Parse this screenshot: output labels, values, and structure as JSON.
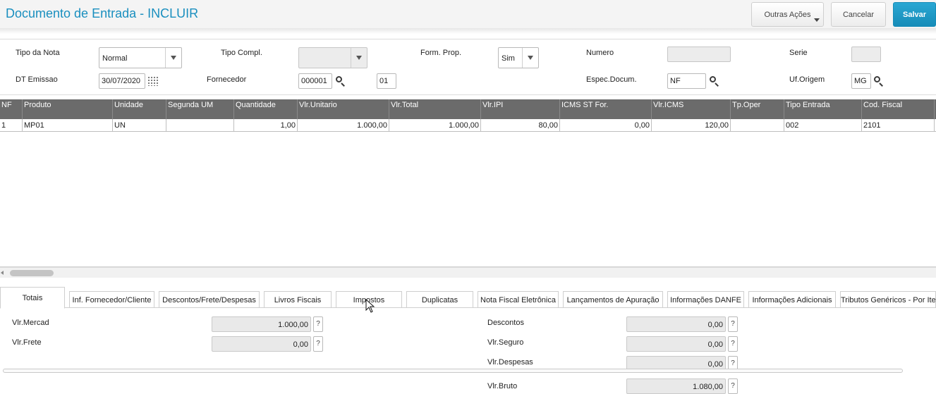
{
  "header": {
    "title": "Documento de Entrada - INCLUIR",
    "btn_outras": "Outras Ações",
    "btn_cancelar": "Cancelar",
    "btn_salvar": "Salvar"
  },
  "form": {
    "tipo_nota_label": "Tipo da Nota",
    "tipo_nota_value": "Normal",
    "tipo_compl_label": "Tipo Compl.",
    "tipo_compl_value": "",
    "form_prop_label": "Form. Prop.",
    "form_prop_value": "Sim",
    "numero_label": "Numero",
    "numero_value": "",
    "serie_label": "Serie",
    "serie_value": "",
    "dt_emissao_label": "DT Emissao",
    "dt_emissao_value": "30/07/2020",
    "fornecedor_label": "Fornecedor",
    "fornecedor_value": "000001",
    "loja_value": "01",
    "espec_label": "Espec.Docum.",
    "espec_value": "NF",
    "uf_label": "Uf.Origem",
    "uf_value": "MG"
  },
  "grid": {
    "columns": [
      "NF",
      "Produto",
      "Unidade",
      "Segunda UM",
      "Quantidade",
      "Vlr.Unitario",
      "Vlr.Total",
      "Vlr.IPI",
      "ICMS ST For.",
      "Vlr.ICMS",
      "Tp.Oper",
      "Tipo Entrada",
      "Cod. Fiscal"
    ],
    "rows": [
      [
        "1",
        "MP01",
        "UN",
        "",
        "1,00",
        "1.000,00",
        "1.000,00",
        "80,00",
        "0,00",
        "120,00",
        "",
        "002",
        "2101"
      ]
    ]
  },
  "tabs": [
    "Totais",
    "Inf. Fornecedor/Cliente",
    "Descontos/Frete/Despesas",
    "Livros Fiscais",
    "Impostos",
    "Duplicatas",
    "Nota Fiscal Eletrônica",
    "Lançamentos de Apuração",
    "Informações DANFE",
    "Informações Adicionais",
    "Tributos Genéricos - Por Ite"
  ],
  "active_tab": "Totais",
  "totals": {
    "vlr_mercad_label": "Vlr.Mercad",
    "vlr_mercad_value": "1.000,00",
    "vlr_frete_label": "Vlr.Frete",
    "vlr_frete_value": "0,00",
    "descontos_label": "Descontos",
    "descontos_value": "0,00",
    "vlr_seguro_label": "Vlr.Seguro",
    "vlr_seguro_value": "0,00",
    "vlr_despesas_label": "Vlr.Despesas",
    "vlr_despesas_value": "0,00",
    "vlr_bruto_label": "Vlr.Bruto",
    "vlr_bruto_value": "1.080,00",
    "help_glyph": "?"
  },
  "colors": {
    "accent": "#1a8fbf",
    "grid_header": "#6b6b6b"
  }
}
